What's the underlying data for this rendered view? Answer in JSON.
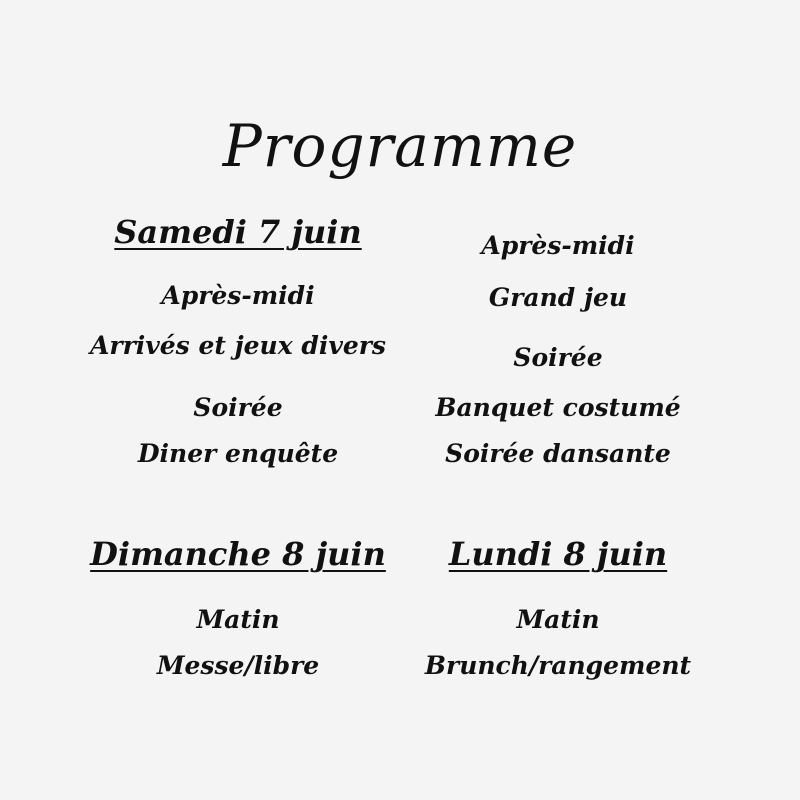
{
  "title": "Programme",
  "colors": {
    "background": "#f4f4f4",
    "text": "#111111"
  },
  "samedi": {
    "heading": "Samedi 7 juin",
    "afternoon_label": "Après-midi",
    "afternoon_activity": "Arrivés et jeux divers",
    "evening_label": "Soirée",
    "evening_activity": "Diner enquête"
  },
  "samedi_suite": {
    "afternoon_label": "Après-midi",
    "afternoon_activity": "Grand jeu",
    "evening_label": "Soirée",
    "evening_activity_1": "Banquet costumé",
    "evening_activity_2": "Soirée dansante"
  },
  "dimanche": {
    "heading": "Dimanche 8 juin",
    "morning_label": "Matin",
    "morning_activity": "Messe/libre"
  },
  "lundi": {
    "heading": "Lundi 8 juin",
    "morning_label": "Matin",
    "morning_activity": "Brunch/rangement"
  }
}
